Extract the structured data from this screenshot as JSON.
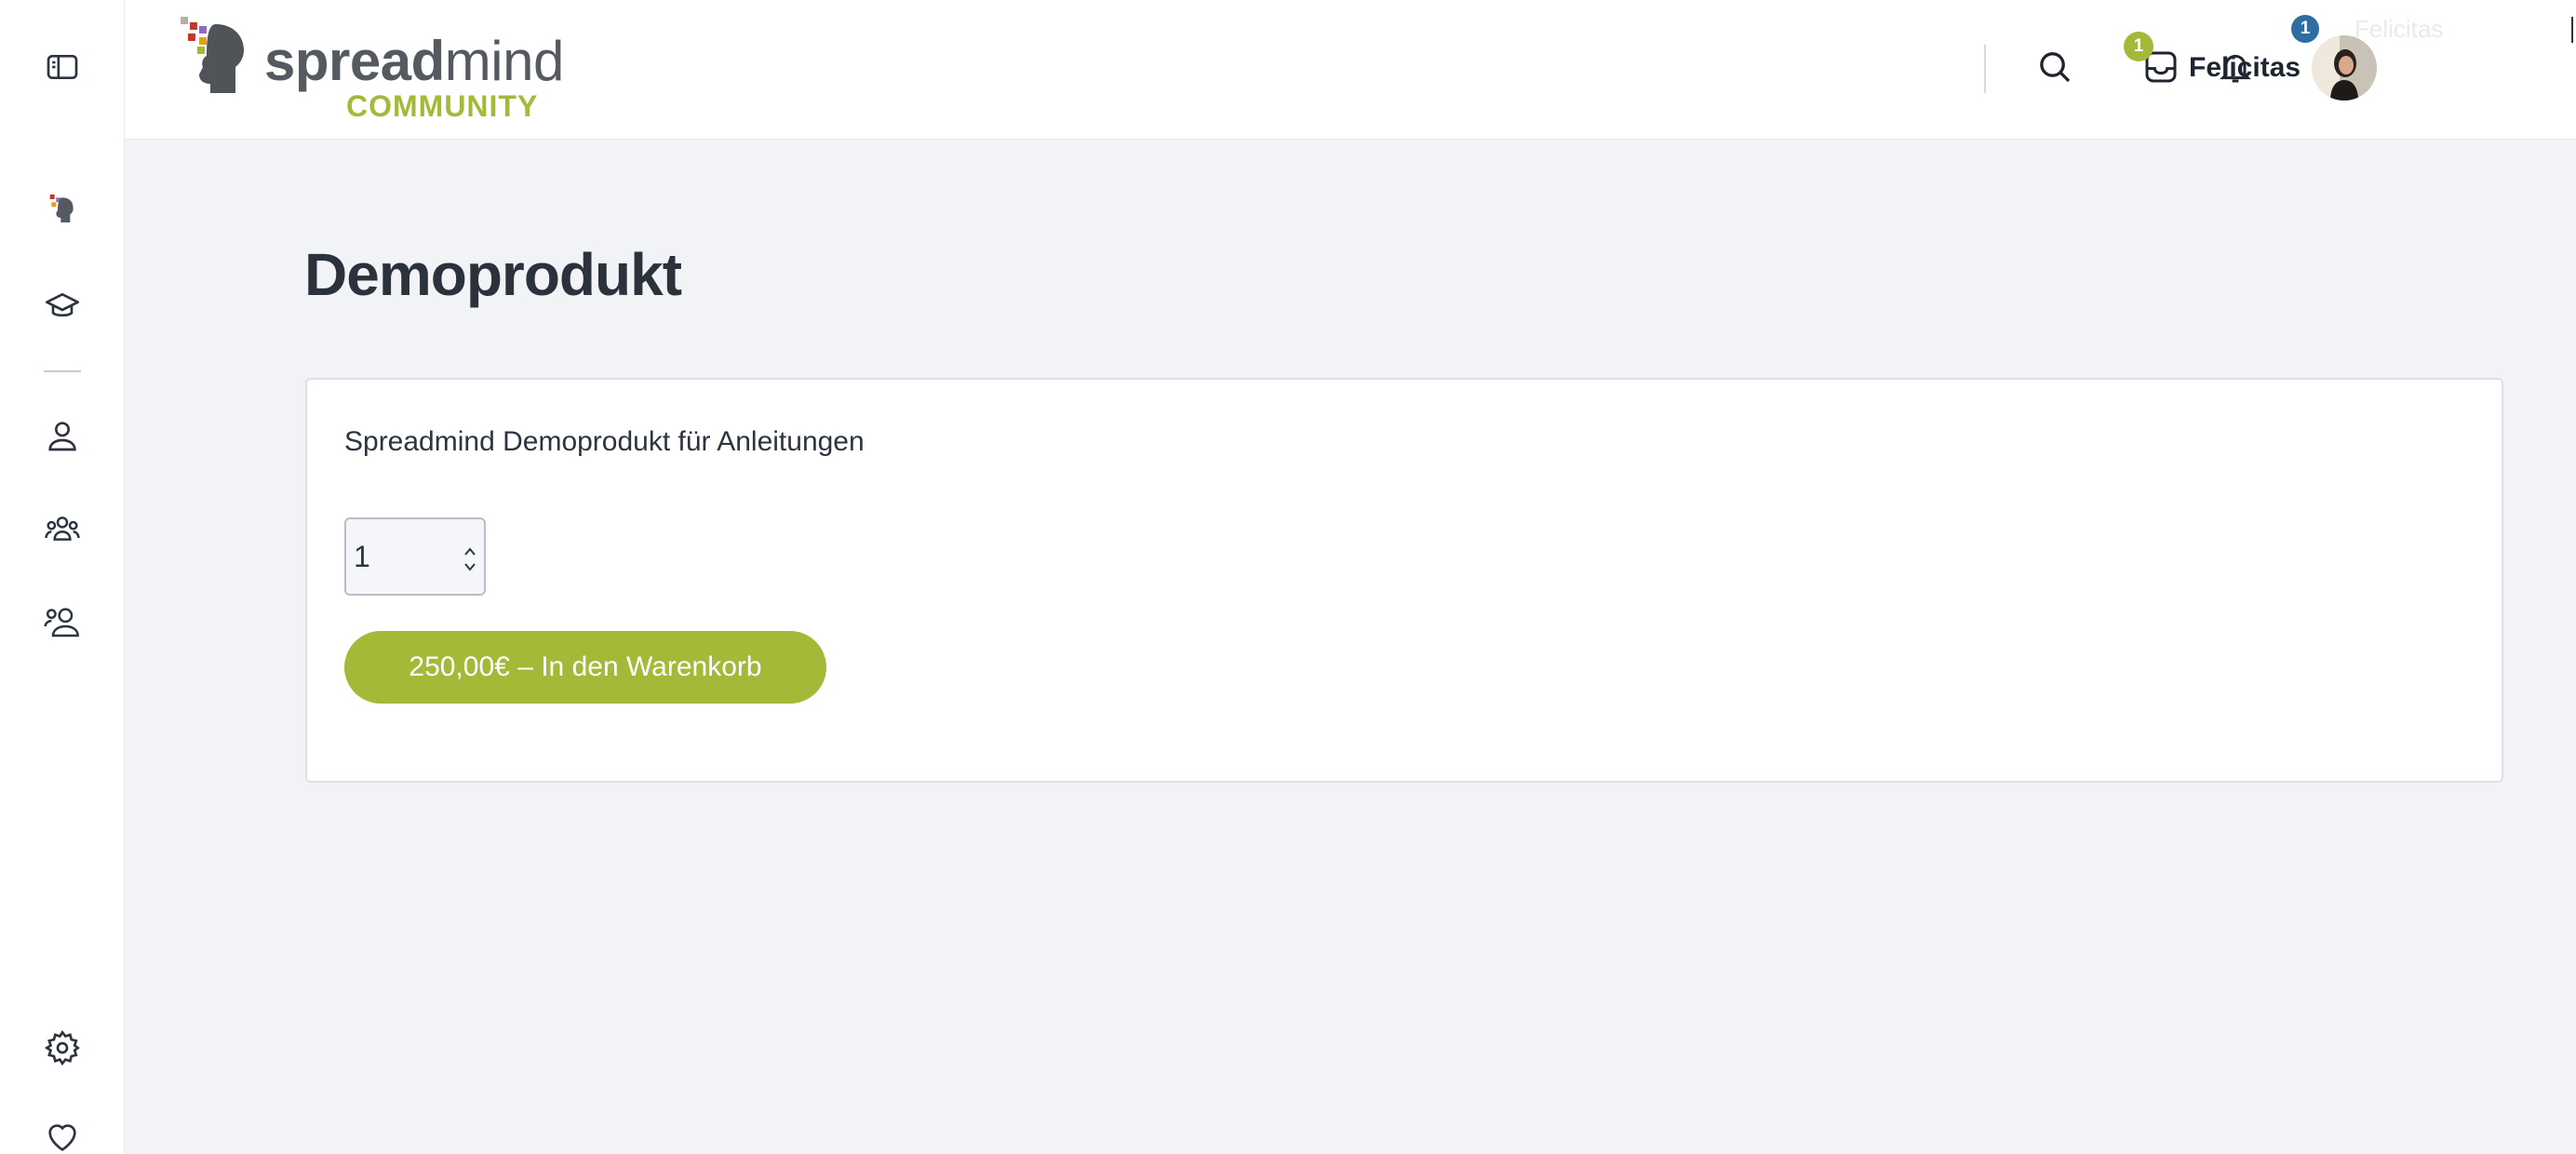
{
  "header": {
    "logo": {
      "word_bold": "spread",
      "word_light": "mind",
      "sub": "COMMUNITY"
    },
    "notifications_count": "1",
    "user_name": "Felicitas",
    "avatar_badge": "1",
    "ghost_name": "Felicitas"
  },
  "sidebar": {
    "items": [
      {
        "icon": "sidebar-toggle-icon"
      },
      {
        "icon": "spreadmind-logo-icon"
      },
      {
        "icon": "graduation-cap-icon"
      },
      {
        "icon": "user-icon"
      },
      {
        "icon": "group-icon"
      },
      {
        "icon": "users-icon"
      },
      {
        "icon": "gear-icon"
      },
      {
        "icon": "heart-icon"
      }
    ]
  },
  "main": {
    "title": "Demoprodukt",
    "description": "Spreadmind Demoprodukt für Anleitungen",
    "quantity": "1",
    "add_to_cart_label": "250,00€ – In den Warenkorb"
  },
  "colors": {
    "accent": "#a3b937",
    "badge_blue": "#2e6da4",
    "background": "#f2f3f7"
  }
}
